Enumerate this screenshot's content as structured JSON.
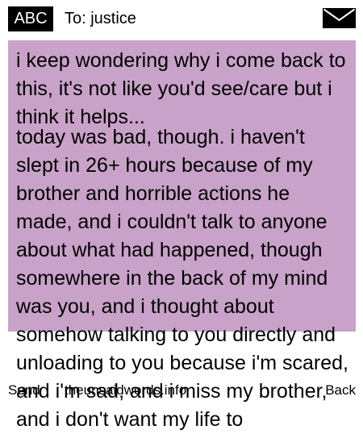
{
  "header": {
    "badge_label": "ABC",
    "recipient_label": "To: justice",
    "mail_icon": "envelope-icon"
  },
  "message": {
    "paragraphs": [
      "i keep wondering why i come back to this, it's not like you'd see/care but i think it helps...",
      "today was bad, though. i haven't slept in 26+ hours because of my brother and horrible actions he made, and i couldn't talk to anyone about what had happened, though somewhere in the back of my mind was you, and i thought about somehow talking to you directly and unloading to you because i'm scared, and i'm sad, and i miss my brother, and i don't want my life to"
    ],
    "panel_color": "#c8a2c8"
  },
  "footer": {
    "send_label": "Send",
    "site_label": "theunsaidwords.info",
    "back_label": "Back"
  }
}
